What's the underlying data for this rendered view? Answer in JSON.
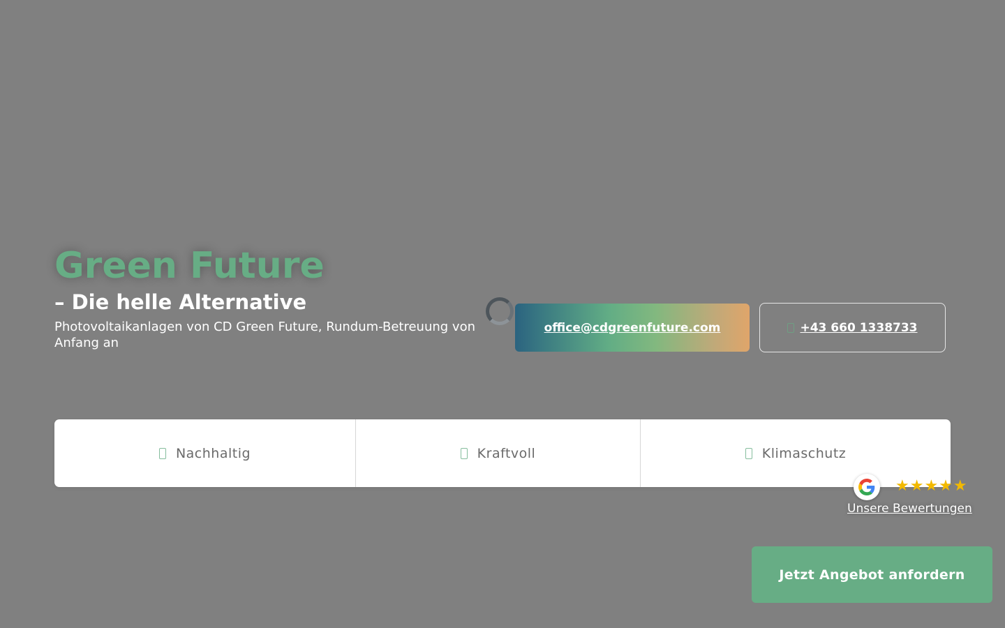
{
  "hero": {
    "title": "Green Future",
    "subtitle": "– Die helle Alternative",
    "description": "Photovoltaikanlagen von CD Green Future, Rundum-Betreuung von Anfang an"
  },
  "contact": {
    "email_label": "office@cdgreenfuture.com",
    "phone_label": "+43 660 1338733"
  },
  "features": [
    {
      "label": "Nachhaltig",
      "icon": "leaf-icon"
    },
    {
      "label": "Kraftvoll",
      "icon": "bolt-icon"
    },
    {
      "label": "Klimaschutz",
      "icon": "globe-icon"
    }
  ],
  "reviews": {
    "stars": "★★★★★",
    "rating_count": 5,
    "link_label": "Unsere Bewertungen"
  },
  "cta": {
    "label": "Jetzt Angebot anfordern"
  },
  "colors": {
    "page_overlay": "#808080",
    "accent_green": "#67ad85",
    "star_gold": "#f2b900"
  }
}
